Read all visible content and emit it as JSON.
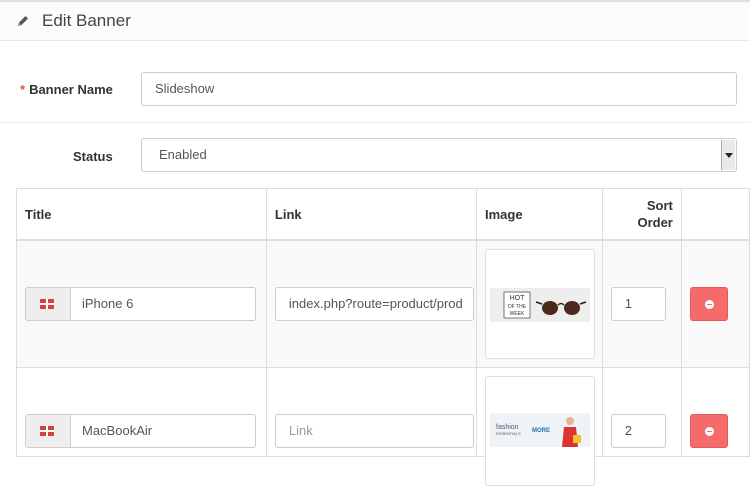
{
  "header": {
    "title": "Edit Banner",
    "icon": "pencil-icon"
  },
  "form": {
    "banner_name_label": "Banner Name",
    "banner_name_value": "Slideshow",
    "status_label": "Status",
    "status_value": "Enabled"
  },
  "table": {
    "columns": [
      "Title",
      "Link",
      "Image",
      "Sort Order"
    ],
    "rows": [
      {
        "title": "iPhone 6",
        "link": "index.php?route=product/prod",
        "link_placeholder": "",
        "image_text": "HOT OF THE WEEK",
        "sort": "1"
      },
      {
        "title": "MacBookAir",
        "link": "",
        "link_placeholder": "Link",
        "image_text": "fashion ESSENTIALS MORE",
        "sort": "2"
      }
    ]
  },
  "colors": {
    "danger": "#f56b6b",
    "required": "#e3503e"
  }
}
